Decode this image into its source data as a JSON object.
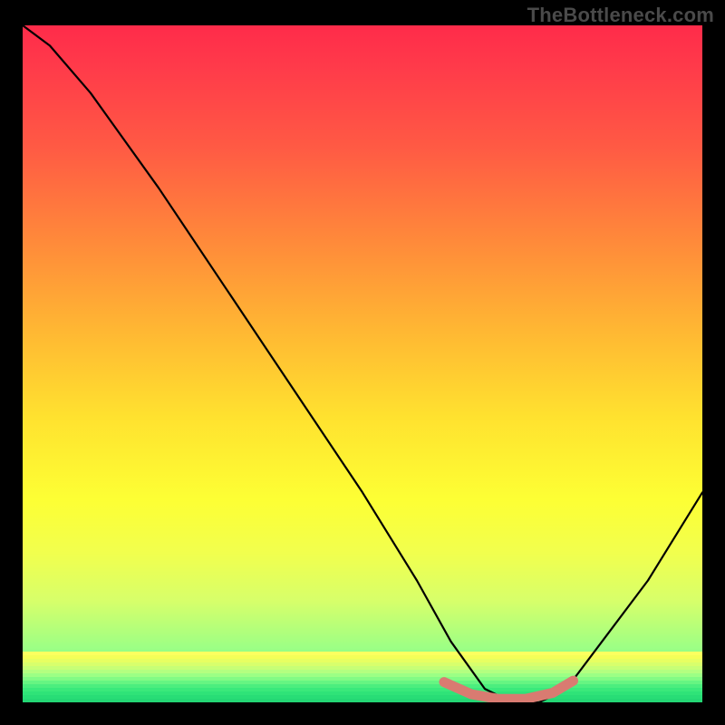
{
  "watermark": "TheBottleneck.com",
  "chart_data": {
    "type": "line",
    "title": "",
    "xlabel": "",
    "ylabel": "",
    "xlim": [
      0,
      100
    ],
    "ylim": [
      0,
      100
    ],
    "grid": false,
    "series": [
      {
        "name": "curve",
        "color": "#000000",
        "x": [
          0,
          4,
          10,
          20,
          30,
          40,
          50,
          58,
          63,
          68,
          72,
          76,
          80,
          86,
          92,
          100
        ],
        "values": [
          100,
          97,
          90,
          76,
          61,
          46,
          31,
          18,
          9,
          2,
          0,
          0,
          2,
          10,
          18,
          31
        ]
      },
      {
        "name": "flat-bottom-highlight",
        "color": "#d97b71",
        "x": [
          62,
          66,
          70,
          74,
          78,
          81
        ],
        "values": [
          3.0,
          1.2,
          0.5,
          0.5,
          1.4,
          3.2
        ]
      }
    ],
    "background_gradient_stops": [
      {
        "pos": 0,
        "color": "#ff2b4a"
      },
      {
        "pos": 6,
        "color": "#ff3a4a"
      },
      {
        "pos": 18,
        "color": "#ff5a44"
      },
      {
        "pos": 32,
        "color": "#ff8a3a"
      },
      {
        "pos": 45,
        "color": "#ffb733"
      },
      {
        "pos": 58,
        "color": "#ffe22f"
      },
      {
        "pos": 70,
        "color": "#fdff34"
      },
      {
        "pos": 78,
        "color": "#f1ff4e"
      },
      {
        "pos": 85,
        "color": "#d7ff6a"
      },
      {
        "pos": 92,
        "color": "#9cff85"
      },
      {
        "pos": 100,
        "color": "#33e97a"
      }
    ],
    "bottom_stripe_colors": [
      "#fdff60",
      "#f4ff58",
      "#e7ff62",
      "#d8ff6c",
      "#c7ff76",
      "#b3ff80",
      "#9cff85",
      "#82fb85",
      "#66f582",
      "#4cee7e",
      "#3ae97b",
      "#2fe378",
      "#28dd76",
      "#24d774"
    ]
  }
}
